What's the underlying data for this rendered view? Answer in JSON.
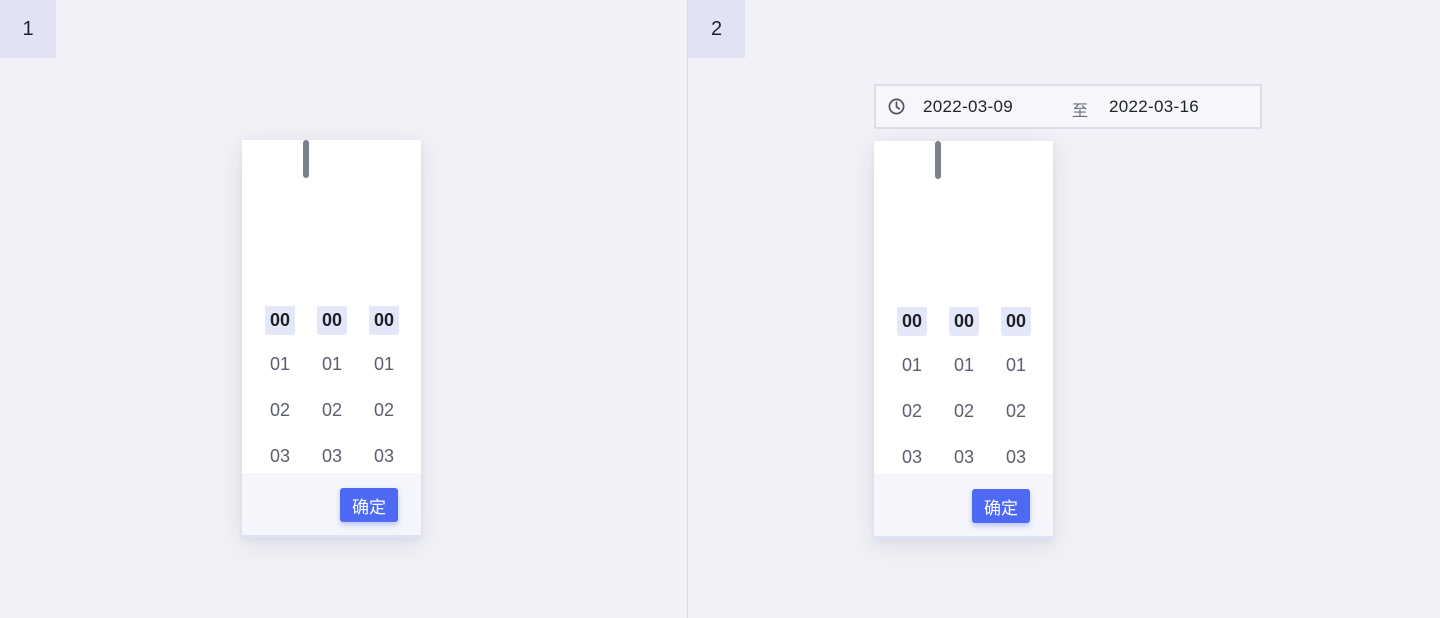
{
  "steps": [
    {
      "label": "1"
    },
    {
      "label": "2"
    }
  ],
  "range": {
    "icon": "clock-icon",
    "start": "2022-03-09",
    "separator": "至",
    "end": "2022-03-16"
  },
  "picker": {
    "hours": [
      "00",
      "01",
      "02",
      "03"
    ],
    "minutes": [
      "00",
      "01",
      "02",
      "03"
    ],
    "seconds": [
      "00",
      "01",
      "02",
      "03"
    ],
    "selected_index": 0,
    "ok_label": "确定"
  },
  "colors": {
    "accent": "#4e69f3",
    "selected_bg": "#e4e7f8",
    "page_bg": "#f1f1f7",
    "badge_bg": "#e1e3f3"
  }
}
